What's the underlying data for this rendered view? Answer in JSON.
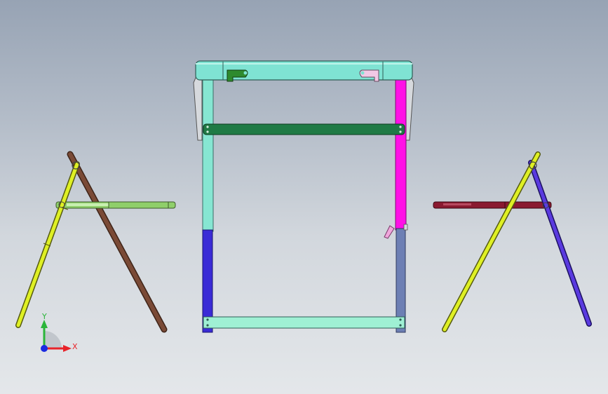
{
  "viewport": {
    "background_top": "#97a3b4",
    "background_bottom": "#e4e7ea"
  },
  "triad": {
    "x_label": "X",
    "y_label": "Y",
    "x_color": "#e8232a",
    "y_color": "#2bb53a",
    "z_color": "#1a2ae0"
  },
  "parts": {
    "left_front_leg": "#dff024",
    "left_rear_leg": "#7a4a36",
    "left_seat": "#8fcf6a",
    "frame_top_rail": "#7fe3d3",
    "left_upright": "#86e6d2",
    "right_upright": "#ff10e6",
    "cross_bar": "#1f7a45",
    "left_lower_leg": "#3a2bd6",
    "right_lower_leg": "#6d7fb4",
    "bottom_bar": "#9ff0d4",
    "latch_left": "#2e8a2e",
    "latch_right": "#f2c9e6",
    "pin": "#f0a6dc",
    "right_seat": "#8a1a30",
    "right_front_leg": "#dff024",
    "right_rear_leg": "#5a3ae0"
  }
}
